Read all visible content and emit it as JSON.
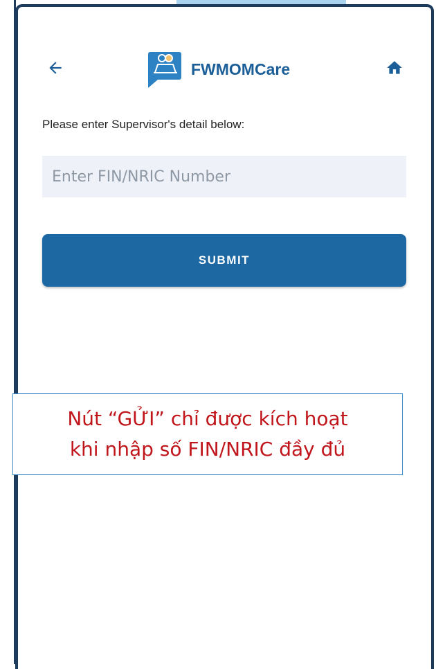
{
  "app": {
    "title": "FWMOMCare",
    "icons": {
      "back": "arrow-left-icon",
      "home": "home-icon",
      "logo": "fwmomcare-logo-icon"
    }
  },
  "form": {
    "prompt": "Please enter Supervisor's detail below:",
    "fin_placeholder": "Enter FIN/NRIC Number",
    "fin_value": "",
    "submit_label": "SUBMIT"
  },
  "annotation": {
    "line1": "Nút “GỬI” chỉ được kích hoạt",
    "line2": "khi nhập số FIN/NRIC đầy đủ"
  },
  "colors": {
    "brand": "#1c5f98",
    "submit": "#1d68a3",
    "input_bg": "#eef2f8",
    "annotation_text": "#c0151b",
    "annotation_border": "#3a86c6"
  }
}
